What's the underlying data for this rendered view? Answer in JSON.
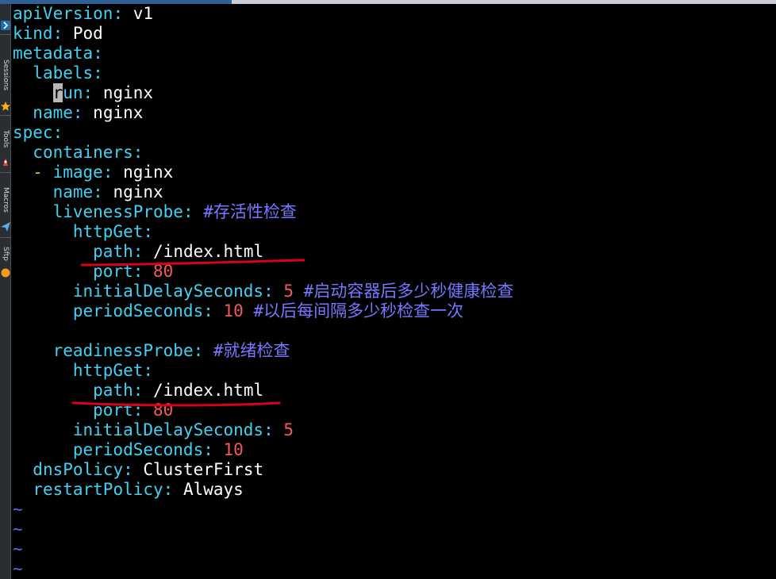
{
  "sidebar": {
    "items": [
      {
        "label": "Sessions",
        "icon": "star-icon"
      },
      {
        "label": "Tools",
        "icon": "rocket-icon"
      },
      {
        "label": "Macros",
        "icon": "paper-plane-icon"
      },
      {
        "label": "Sftp",
        "icon": "circle-icon"
      }
    ],
    "top_icon": "chevron-right-icon"
  },
  "editor": {
    "lines": [
      {
        "indent": "",
        "key": "apiVersion",
        "value": "v1"
      },
      {
        "indent": "",
        "key": "kind",
        "value": "Pod"
      },
      {
        "indent": "",
        "key": "metadata",
        "value": ""
      },
      {
        "indent": "  ",
        "key": "labels",
        "value": ""
      },
      {
        "indent": "    ",
        "key": "run",
        "value": "nginx"
      },
      {
        "indent": "  ",
        "key": "name",
        "value": "nginx"
      },
      {
        "indent": "",
        "key": "spec",
        "value": ""
      },
      {
        "indent": "  ",
        "key": "containers",
        "value": ""
      },
      {
        "indent": "  ",
        "dash": "- ",
        "key": "image",
        "value": "nginx"
      },
      {
        "indent": "    ",
        "key": "name",
        "value": "nginx"
      },
      {
        "indent": "    ",
        "key": "livenessProbe",
        "comment": "#存活性检查"
      },
      {
        "indent": "      ",
        "key": "httpGet",
        "value": ""
      },
      {
        "indent": "        ",
        "key": "path",
        "value": "/index.html"
      },
      {
        "indent": "        ",
        "key": "port",
        "number": "80"
      },
      {
        "indent": "      ",
        "key": "initialDelaySeconds",
        "number": "5",
        "comment": "#启动容器后多少秒健康检查"
      },
      {
        "indent": "      ",
        "key": "periodSeconds",
        "number": "10",
        "comment": "#以后每间隔多少秒检查一次"
      },
      {
        "indent": "",
        "key": "",
        "value": ""
      },
      {
        "indent": "    ",
        "key": "readinessProbe",
        "comment": "#就绪检查"
      },
      {
        "indent": "      ",
        "key": "httpGet",
        "value": ""
      },
      {
        "indent": "        ",
        "key": "path",
        "value": "/index.html"
      },
      {
        "indent": "        ",
        "key": "port",
        "number": "80"
      },
      {
        "indent": "      ",
        "key": "initialDelaySeconds",
        "number": "5"
      },
      {
        "indent": "      ",
        "key": "periodSeconds",
        "number": "10"
      },
      {
        "indent": "  ",
        "key": "dnsPolicy",
        "value": "ClusterFirst"
      },
      {
        "indent": "  ",
        "key": "restartPolicy",
        "value": "Always"
      }
    ],
    "empty_marker": "~",
    "empty_marker_count": 4,
    "cursor_char": "r",
    "colors": {
      "key": "#3fd2f3",
      "value": "#ffffff",
      "number": "#f25a5a",
      "comment": "#7777ff",
      "dash": "#e3c321",
      "annotation": "#d8001a"
    }
  }
}
